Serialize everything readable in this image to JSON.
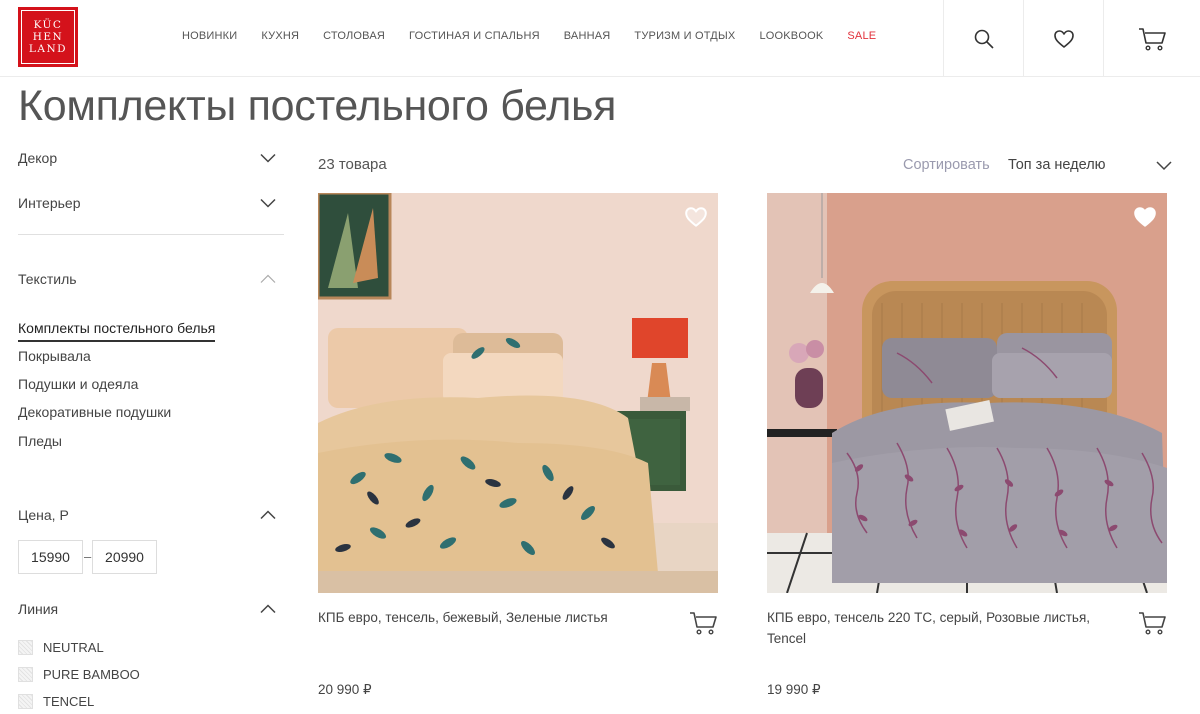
{
  "header": {
    "logo_lines": [
      "KÜC",
      "HEN",
      "LAND"
    ],
    "nav": [
      {
        "label": "Новинки"
      },
      {
        "label": "Кухня"
      },
      {
        "label": "Столовая"
      },
      {
        "label": "Гостиная и спальня"
      },
      {
        "label": "Ванная"
      },
      {
        "label": "Туризм и отдых"
      },
      {
        "label": "Lookbook"
      },
      {
        "label": "Sale"
      }
    ],
    "icons": [
      "search-icon",
      "heart-icon",
      "cart-icon"
    ],
    "accent_color": "#d4121b",
    "sale_color": "#e2323c"
  },
  "page": {
    "title": "Комплекты постельного белья"
  },
  "sidebar": {
    "categories": [
      {
        "label": "Декор",
        "expanded": false
      },
      {
        "label": "Интерьер",
        "expanded": false
      },
      {
        "label": "Текстиль",
        "expanded": true
      }
    ],
    "textile_items": [
      {
        "label": "Комплекты постельного белья",
        "active": true
      },
      {
        "label": "Покрывала"
      },
      {
        "label": "Подушки и одеяла"
      },
      {
        "label": "Декоративные подушки"
      },
      {
        "label": "Пледы"
      }
    ],
    "price": {
      "label": "Цена, Р",
      "min": "15990",
      "max": "20990",
      "separator": "–"
    },
    "line": {
      "label": "Линия",
      "options": [
        {
          "label": "NEUTRAL"
        },
        {
          "label": "PURE BAMBOO"
        },
        {
          "label": "TENCEL"
        }
      ]
    }
  },
  "toolbar": {
    "count": "23 товара",
    "sort_label": "Сортировать",
    "sort_value": "Топ за неделю"
  },
  "products": [
    {
      "name": "КПБ евро, тенсель, бежевый, Зеленые листья",
      "price": "20 990 ₽"
    },
    {
      "name": "КПБ евро, тенсель 220 TC, серый, Розовые листья, Tencel",
      "price": "19 990 ₽"
    }
  ]
}
